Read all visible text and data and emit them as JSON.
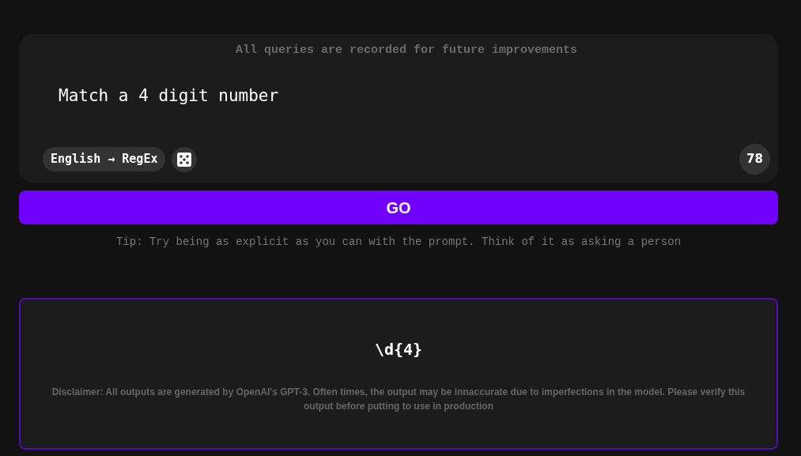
{
  "notice": "All queries are recorded for future improvements",
  "prompt": {
    "value": "Match a 4 digit number"
  },
  "mode": {
    "from": "English",
    "arrow": "→",
    "to": "RegEx"
  },
  "char_count": "78",
  "go_button": "GO",
  "tip": "Tip: Try being as explicit as you can with the prompt. Think of it as asking a person",
  "output": {
    "result": "\\d{4}",
    "disclaimer": "Disclaimer: All outputs are generated by OpenAI's GPT-3. Often times, the output may be innaccurate due to imperfections in the model. Please verify this output before putting to use in production"
  }
}
